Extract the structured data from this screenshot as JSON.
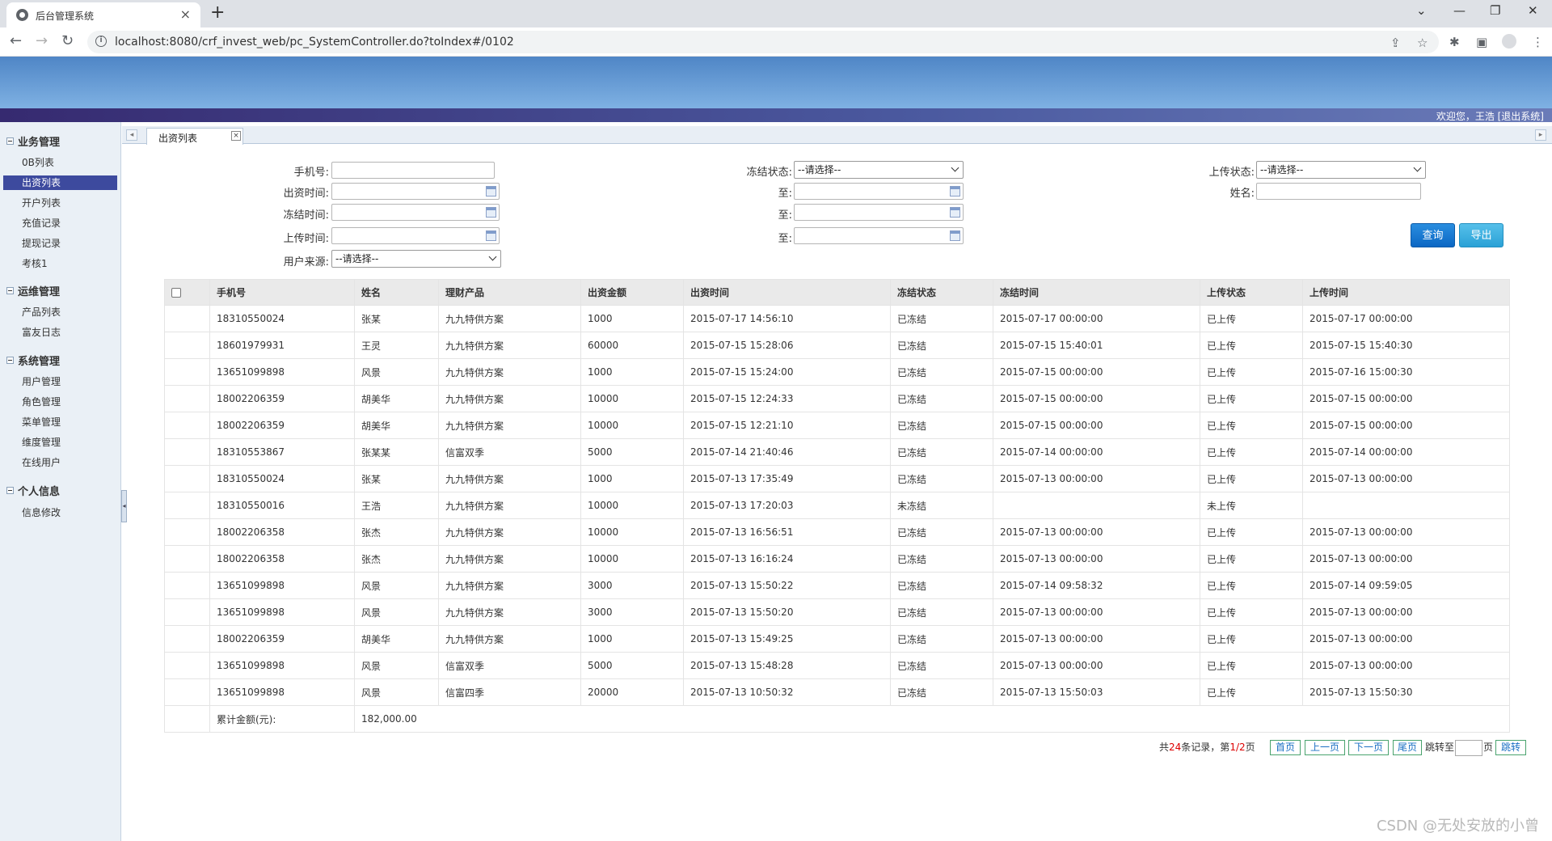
{
  "browser": {
    "tab_title": "后台管理系统",
    "tab_close": "×",
    "new_tab": "+",
    "url": "localhost:8080/crf_invest_web/pc_SystemController.do?toIndex#/0102",
    "info": "i"
  },
  "header": {
    "welcome": "欢迎您，王浩    [退出系统]"
  },
  "sidebar": {
    "groups": [
      {
        "label": "业务管理",
        "items": [
          "0B列表",
          "出资列表",
          "开户列表",
          "充值记录",
          "提现记录",
          "考核1"
        ]
      },
      {
        "label": "运维管理",
        "items": [
          "产品列表",
          "富友日志"
        ]
      },
      {
        "label": "系统管理",
        "items": [
          "用户管理",
          "角色管理",
          "菜单管理",
          "维度管理",
          "在线用户"
        ]
      },
      {
        "label": "个人信息",
        "items": [
          "信息修改"
        ]
      }
    ],
    "active_item": "出资列表"
  },
  "content_tab": {
    "label": "出资列表",
    "close": "×"
  },
  "filters": {
    "phone_label": "手机号:",
    "invest_time_label": "出资时间:",
    "freeze_time_label": "冻结时间:",
    "upload_time_label": "上传时间:",
    "source_label": "用户来源:",
    "freeze_status_label": "冻结状态:",
    "to_label": "至:",
    "upload_status_label": "上传状态:",
    "name_label": "姓名:",
    "select_placeholder": "--请选择--",
    "query_button": "查询",
    "export_button": "导出"
  },
  "table": {
    "columns": [
      "手机号",
      "姓名",
      "理财产品",
      "出资金额",
      "出资时间",
      "冻结状态",
      "冻结时间",
      "上传状态",
      "上传时间"
    ],
    "rows": [
      [
        "18310550024",
        "张某",
        "九九特供方案",
        "1000",
        "2015-07-17 14:56:10",
        "已冻结",
        "2015-07-17 00:00:00",
        "已上传",
        "2015-07-17 00:00:00"
      ],
      [
        "18601979931",
        "王灵",
        "九九特供方案",
        "60000",
        "2015-07-15 15:28:06",
        "已冻结",
        "2015-07-15 15:40:01",
        "已上传",
        "2015-07-15 15:40:30"
      ],
      [
        "13651099898",
        "风景",
        "九九特供方案",
        "1000",
        "2015-07-15 15:24:00",
        "已冻结",
        "2015-07-15 00:00:00",
        "已上传",
        "2015-07-16 15:00:30"
      ],
      [
        "18002206359",
        "胡美华",
        "九九特供方案",
        "10000",
        "2015-07-15 12:24:33",
        "已冻结",
        "2015-07-15 00:00:00",
        "已上传",
        "2015-07-15 00:00:00"
      ],
      [
        "18002206359",
        "胡美华",
        "九九特供方案",
        "10000",
        "2015-07-15 12:21:10",
        "已冻结",
        "2015-07-15 00:00:00",
        "已上传",
        "2015-07-15 00:00:00"
      ],
      [
        "18310553867",
        "张某某",
        "信富双季",
        "5000",
        "2015-07-14 21:40:46",
        "已冻结",
        "2015-07-14 00:00:00",
        "已上传",
        "2015-07-14 00:00:00"
      ],
      [
        "18310550024",
        "张某",
        "九九特供方案",
        "1000",
        "2015-07-13 17:35:49",
        "已冻结",
        "2015-07-13 00:00:00",
        "已上传",
        "2015-07-13 00:00:00"
      ],
      [
        "18310550016",
        "王浩",
        "九九特供方案",
        "10000",
        "2015-07-13 17:20:03",
        "未冻结",
        "",
        "未上传",
        ""
      ],
      [
        "18002206358",
        "张杰",
        "九九特供方案",
        "10000",
        "2015-07-13 16:56:51",
        "已冻结",
        "2015-07-13 00:00:00",
        "已上传",
        "2015-07-13 00:00:00"
      ],
      [
        "18002206358",
        "张杰",
        "九九特供方案",
        "10000",
        "2015-07-13 16:16:24",
        "已冻结",
        "2015-07-13 00:00:00",
        "已上传",
        "2015-07-13 00:00:00"
      ],
      [
        "13651099898",
        "风景",
        "九九特供方案",
        "3000",
        "2015-07-13 15:50:22",
        "已冻结",
        "2015-07-14 09:58:32",
        "已上传",
        "2015-07-14 09:59:05"
      ],
      [
        "13651099898",
        "风景",
        "九九特供方案",
        "3000",
        "2015-07-13 15:50:20",
        "已冻结",
        "2015-07-13 00:00:00",
        "已上传",
        "2015-07-13 00:00:00"
      ],
      [
        "18002206359",
        "胡美华",
        "九九特供方案",
        "1000",
        "2015-07-13 15:49:25",
        "已冻结",
        "2015-07-13 00:00:00",
        "已上传",
        "2015-07-13 00:00:00"
      ],
      [
        "13651099898",
        "风景",
        "信富双季",
        "5000",
        "2015-07-13 15:48:28",
        "已冻结",
        "2015-07-13 00:00:00",
        "已上传",
        "2015-07-13 00:00:00"
      ],
      [
        "13651099898",
        "风景",
        "信富四季",
        "20000",
        "2015-07-13 10:50:32",
        "已冻结",
        "2015-07-13 15:50:03",
        "已上传",
        "2015-07-13 15:50:30"
      ]
    ],
    "total_label": "累计金额(元):",
    "total_value": "182,000.00"
  },
  "pager": {
    "prefix": "共",
    "total_records": "24",
    "records_suffix": "条记录，第",
    "page": "1/2",
    "page_suffix": "页",
    "first": "首页",
    "prev": "上一页",
    "next": "下一页",
    "last": "尾页",
    "jump_to": "跳转至",
    "page_unit": "页",
    "jump": "跳转"
  },
  "watermark": "CSDN @无处安放的小曾",
  "colors": {
    "banner": "#5b92d0",
    "active_item": "#3d4a9e",
    "query_button": "#0b67c4",
    "export_button": "#2aa1d6"
  }
}
